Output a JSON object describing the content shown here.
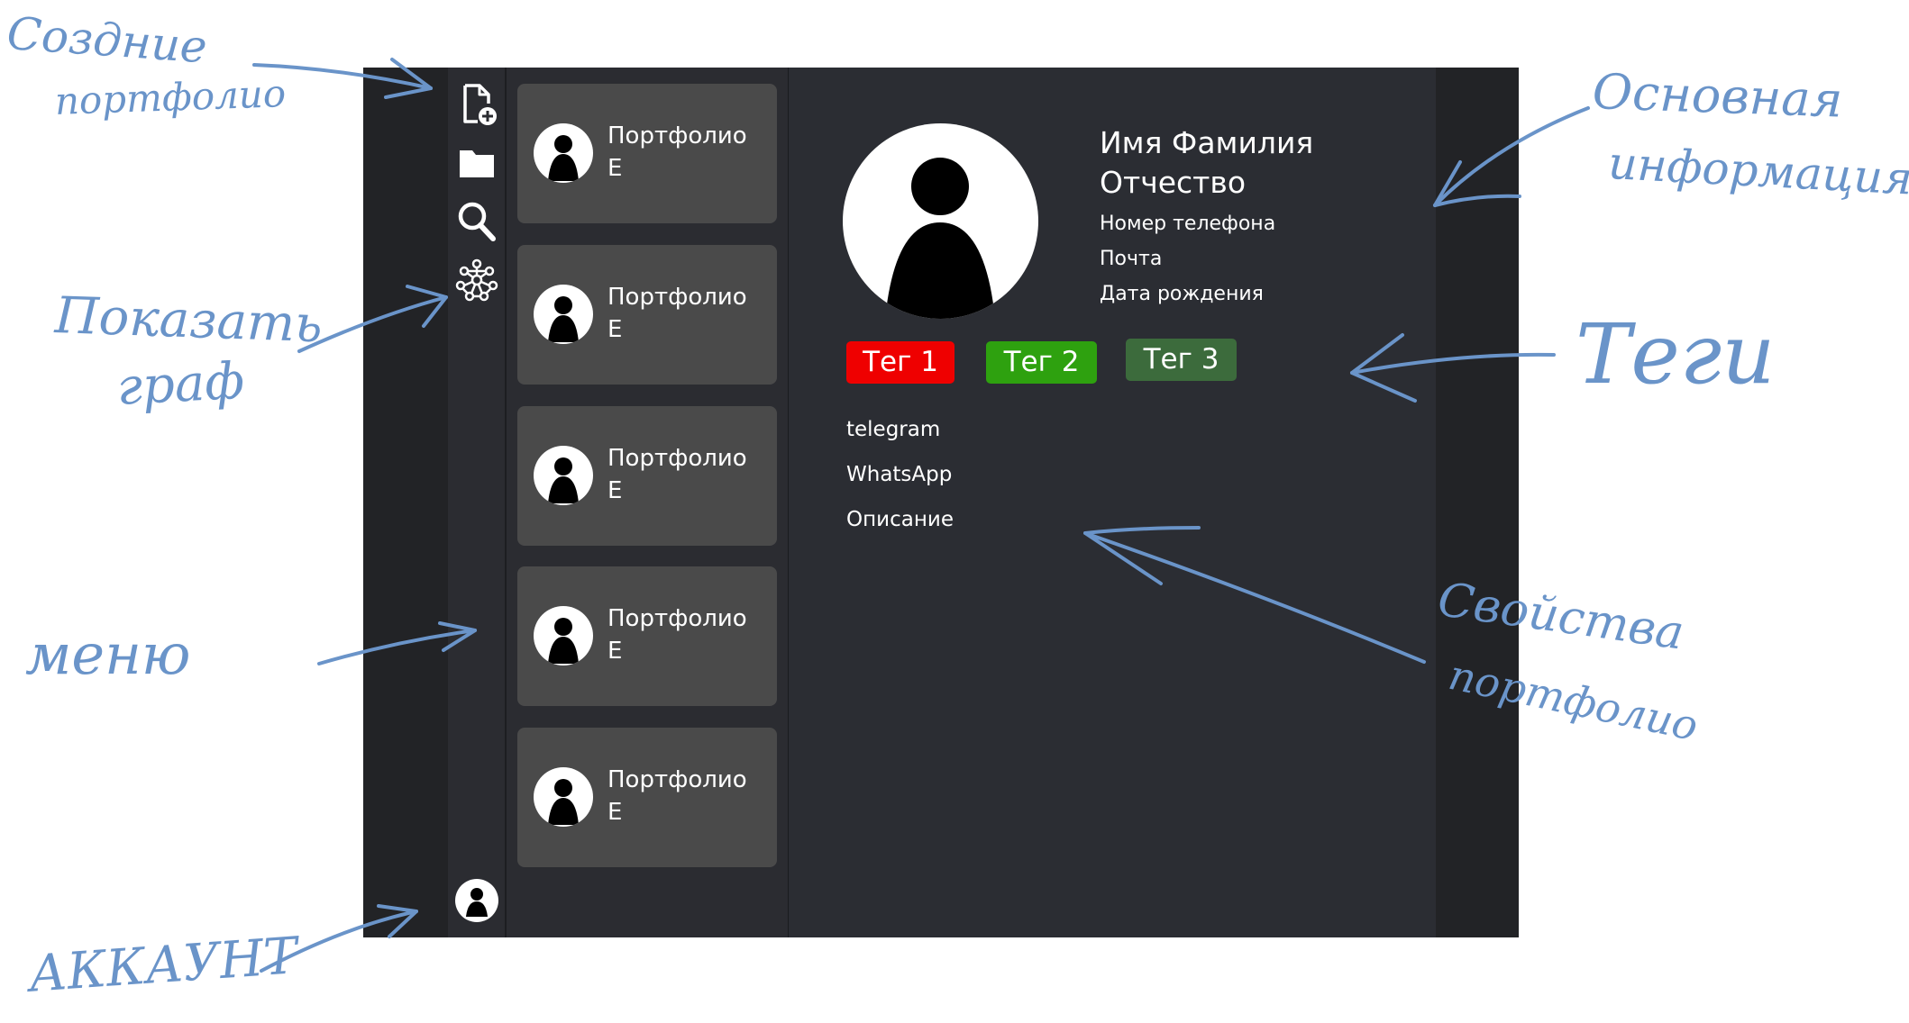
{
  "annotations": {
    "create_portfolio": [
      "Создние",
      "портфолио"
    ],
    "show_graph": [
      "Показать",
      "граф"
    ],
    "menu": "меню",
    "account": "АККАУНТ",
    "main_info": [
      "Основная",
      "информация"
    ],
    "tags": "Теги",
    "portfolio_properties": [
      "Свойства",
      "портфолио"
    ]
  },
  "rail": {
    "icons": [
      "new-file-icon",
      "folder-icon",
      "search-icon",
      "graph-icon"
    ],
    "account_icon": "account-avatar-icon"
  },
  "portfolio_list": [
    {
      "line1": "Портфолио",
      "line2": "Е"
    },
    {
      "line1": "Портфолио",
      "line2": "Е"
    },
    {
      "line1": "Портфолио",
      "line2": "Е"
    },
    {
      "line1": "Портфолио",
      "line2": "Е"
    },
    {
      "line1": "Портфолио",
      "line2": "Е"
    }
  ],
  "profile": {
    "name_line1": "Имя Фамилия",
    "name_line2": "Отчество",
    "phone": "Номер телефона",
    "email": "Почта",
    "birth_date": "Дата рождения"
  },
  "tags": [
    {
      "label": "Тег 1",
      "color": "#ef0000"
    },
    {
      "label": "Тег 2",
      "color": "#2ea10f"
    },
    {
      "label": "Тег 3",
      "color": "#3c6b3c"
    }
  ],
  "properties": {
    "telegram": "telegram",
    "whatsapp": "WhatsApp",
    "description": "Описание"
  },
  "colors": {
    "app_bg": "#222326",
    "panel_bg": "#2b2c31",
    "card_bg": "#4a4a4a",
    "annotation": "#6a94c9"
  }
}
